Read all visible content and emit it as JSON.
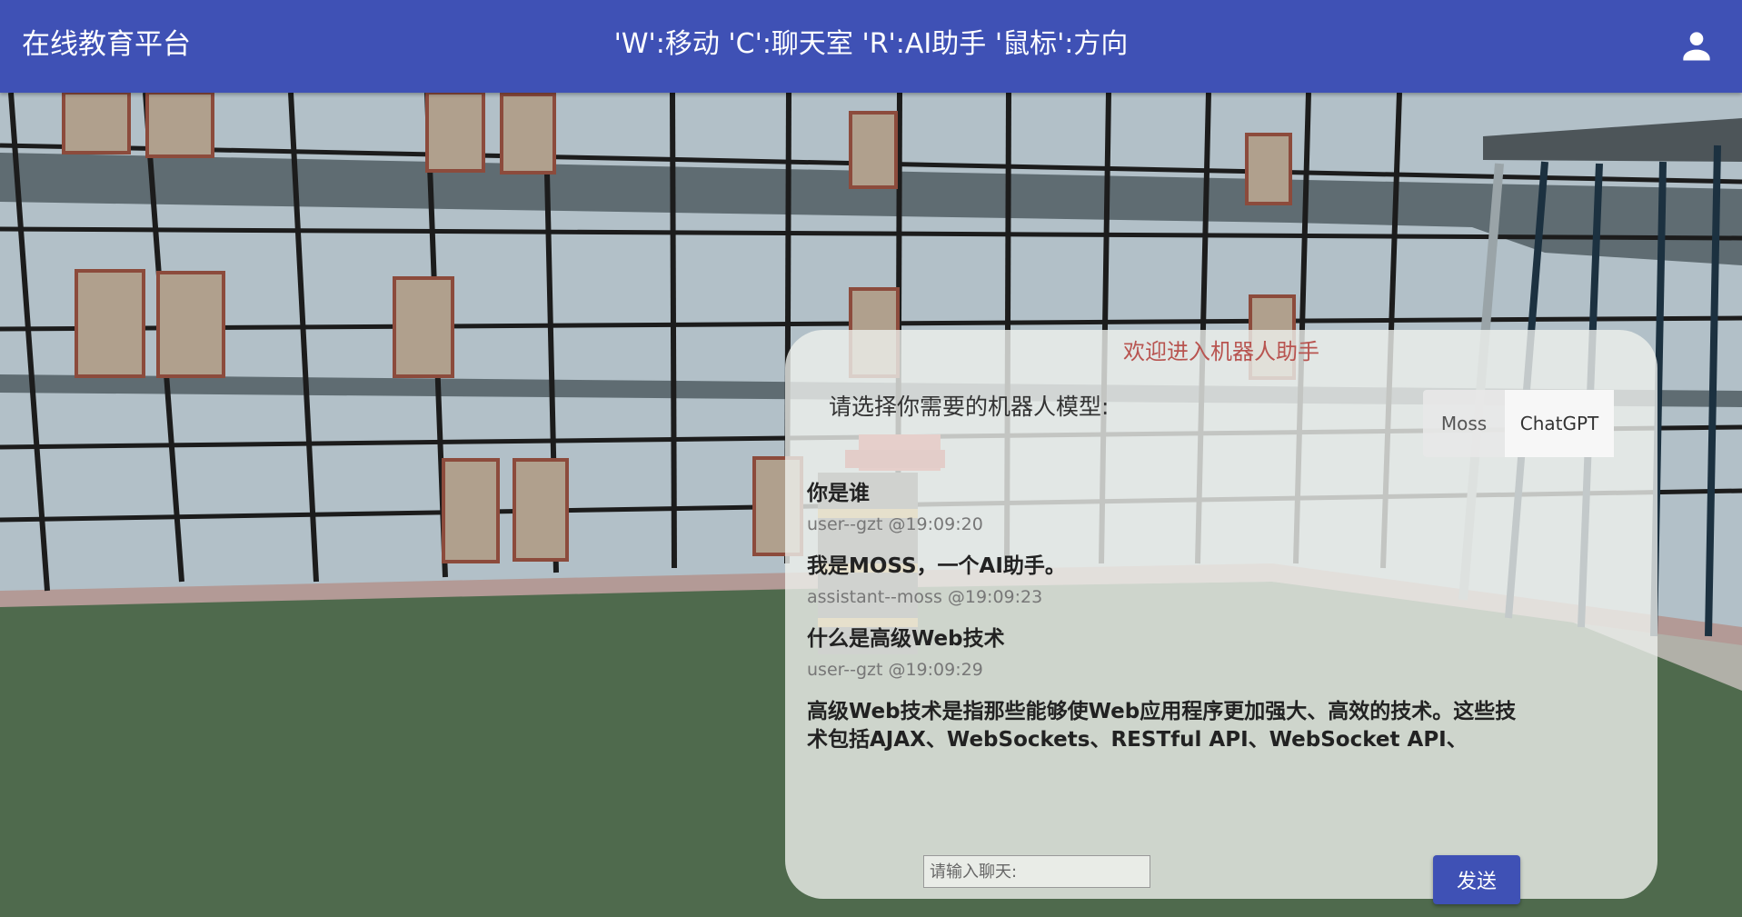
{
  "header": {
    "title": "在线教育平台",
    "hint": "'W':移动 'C':聊天室 'R':AI助手 '鼠标':方向",
    "account_icon": "account-icon",
    "bg_color": "#3f51b5"
  },
  "panel": {
    "title": "欢迎进入机器人助手",
    "model_label": "请选择你需要的机器人模型:",
    "model_options": [
      "Moss",
      "ChatGPT"
    ],
    "selected_model": "ChatGPT"
  },
  "messages": [
    {
      "text": "你是谁",
      "meta": "user--gzt @19:09:20"
    },
    {
      "text": "我是MOSS，一个AI助手。",
      "meta": "assistant--moss @19:09:23"
    },
    {
      "text": "什么是高级Web技术",
      "meta": "user--gzt @19:09:29"
    },
    {
      "text": "高级Web技术是指那些能够使Web应用程序更加强大、高效的技术。这些技术包括AJAX、WebSockets、RESTful API、WebSocket API、"
    }
  ],
  "input": {
    "placeholder": "请输入聊天:",
    "value": ""
  },
  "send_label": "发送"
}
